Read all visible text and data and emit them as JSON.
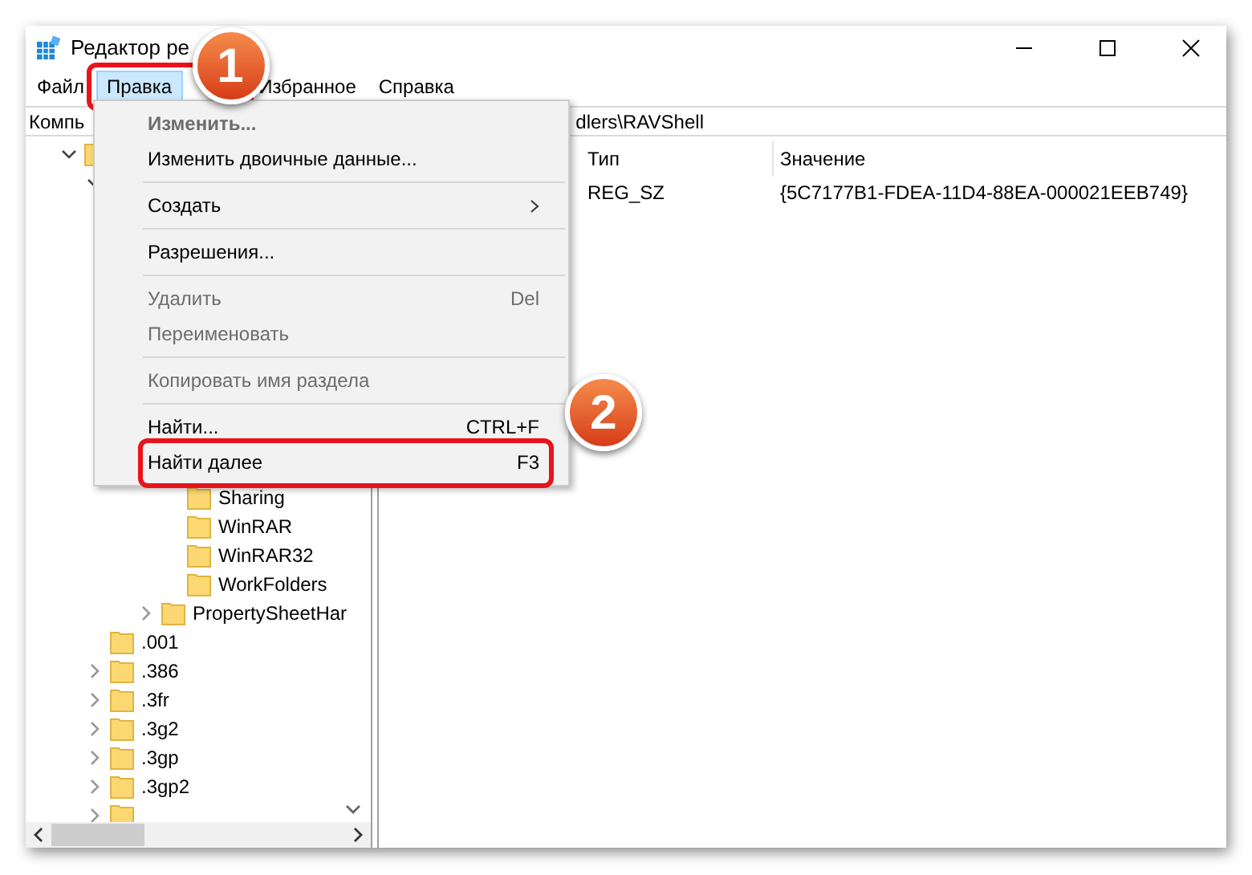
{
  "window": {
    "title": "Редактор ре"
  },
  "menubar": [
    {
      "label": "Файл",
      "selected": false
    },
    {
      "label": "Правка",
      "selected": true,
      "callout": "1"
    },
    {
      "label": "Избранное",
      "selected": false
    },
    {
      "label": "Справка",
      "selected": false
    }
  ],
  "address": {
    "start": "Компь",
    "end": "dlers\\RAVShell"
  },
  "menu": [
    {
      "kind": "item",
      "label": "Изменить...",
      "default": true,
      "disabled": true
    },
    {
      "kind": "item",
      "label": "Изменить двоичные данные...",
      "disabled": false
    },
    {
      "kind": "separator"
    },
    {
      "kind": "item",
      "label": "Создать",
      "disabled": false,
      "submenu": true
    },
    {
      "kind": "separator"
    },
    {
      "kind": "item",
      "label": "Разрешения...",
      "disabled": false
    },
    {
      "kind": "separator"
    },
    {
      "kind": "item",
      "label": "Удалить",
      "shortcut": "Del",
      "disabled": true
    },
    {
      "kind": "item",
      "label": "Переименовать",
      "disabled": true
    },
    {
      "kind": "separator"
    },
    {
      "kind": "item",
      "label": "Копировать имя раздела",
      "disabled": true
    },
    {
      "kind": "separator"
    },
    {
      "kind": "item",
      "label": "Найти...",
      "shortcut": "CTRL+F",
      "disabled": false
    },
    {
      "kind": "item",
      "label": "Найти далее",
      "shortcut": "F3",
      "disabled": false,
      "callout": "2"
    }
  ],
  "tree": [
    {
      "expanded": true,
      "children": [
        {
          "expanded": true,
          "children": [
            {
              "children": [
                {
                  "children": [
                    {
                      "label": "Sharing"
                    },
                    {
                      "label": "WinRAR"
                    },
                    {
                      "label": "WinRAR32"
                    },
                    {
                      "label": "WorkFolders"
                    }
                  ]
                },
                {
                  "label": "PropertySheetHar",
                  "expanded": false,
                  "has_children": true
                }
              ]
            }
          ]
        },
        {
          "label": ".001"
        },
        {
          "label": ".386",
          "expanded": false,
          "has_children": true
        },
        {
          "label": ".3fr",
          "expanded": false,
          "has_children": true
        },
        {
          "label": ".3g2",
          "expanded": false,
          "has_children": true
        },
        {
          "label": ".3gp",
          "expanded": false,
          "has_children": true
        },
        {
          "label": ".3gp2",
          "expanded": false,
          "has_children": true
        },
        {
          "expanded": false,
          "has_children": true
        }
      ]
    }
  ],
  "table": {
    "columns": [
      "Тип",
      "Значение"
    ],
    "rows": [
      {
        "cells": [
          "REG_SZ",
          "{5C7177B1-FDEA-11D4-88EA-000021EEB749}"
        ]
      }
    ]
  }
}
